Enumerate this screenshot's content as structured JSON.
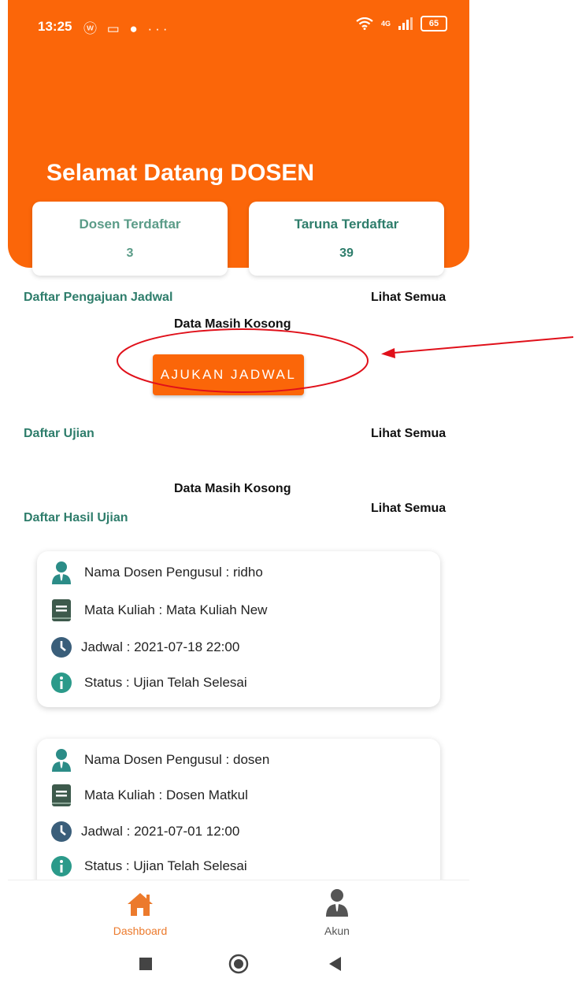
{
  "status_bar": {
    "time": "13:25",
    "notification_icons": "ⓦ ▭ ● ···",
    "network": "4G",
    "battery": "65"
  },
  "header": {
    "welcome": "Selamat Datang DOSEN"
  },
  "stats": [
    {
      "label": "Dosen Terdaftar",
      "value": "3",
      "color": "#5b9c88"
    },
    {
      "label": "Taruna Terdaftar",
      "value": "39",
      "color": "#2e7d6b"
    }
  ],
  "sections": {
    "pengajuan": {
      "title": "Daftar Pengajuan Jadwal",
      "see_all": "Lihat Semua",
      "empty": "Data Masih Kosong",
      "button": "AJUKAN JADWAL"
    },
    "ujian": {
      "title": "Daftar Ujian",
      "see_all": "Lihat Semua",
      "empty": "Data Masih Kosong"
    },
    "hasil": {
      "title": "Daftar Hasil Ujian",
      "see_all": "Lihat Semua"
    }
  },
  "results": [
    {
      "dosen": "Nama Dosen Pengusul : ridho",
      "matkul": "Mata Kuliah : Mata Kuliah New",
      "jadwal": "Jadwal : 2021-07-18 22:00",
      "status": "Status : Ujian Telah Selesai"
    },
    {
      "dosen": "Nama Dosen Pengusul : dosen",
      "matkul": "Mata Kuliah : Dosen Matkul",
      "jadwal": "Jadwal : 2021-07-01 12:00",
      "status": "Status : Ujian Telah Selesai"
    }
  ],
  "bottom_nav": [
    {
      "label": "Dashboard",
      "icon": "home-icon",
      "active": true
    },
    {
      "label": "Akun",
      "icon": "user-icon",
      "active": false
    }
  ],
  "colors": {
    "accent": "#fb6609",
    "teal": "#2e7d6b",
    "icon_teal": "#2b8c87",
    "annotation": "#e0101a"
  }
}
